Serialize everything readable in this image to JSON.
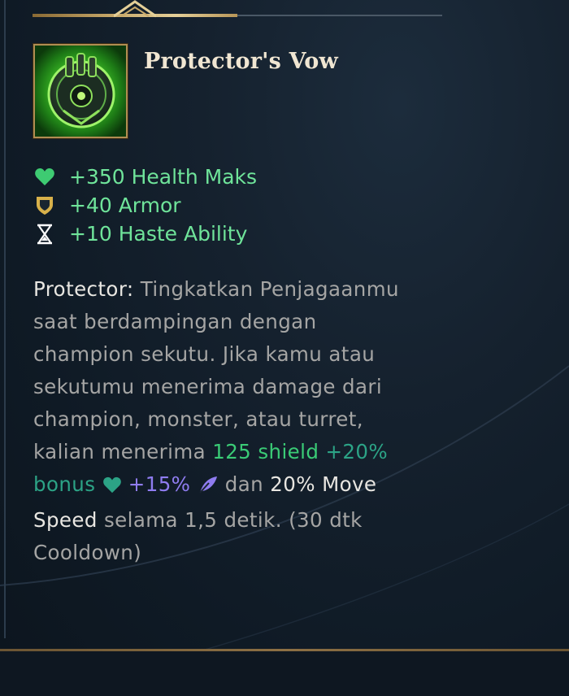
{
  "item": {
    "title": "Protector's Vow",
    "icon": "protectors-vow-item-icon"
  },
  "stats": [
    {
      "icon": "heart-icon",
      "text": "+350 Health Maks",
      "color": "#3ecb72"
    },
    {
      "icon": "shield-icon",
      "text": "+40 Armor",
      "color": "#d8b14a"
    },
    {
      "icon": "hourglass-icon",
      "text": "+10 Haste Ability",
      "color": "#ffffff"
    }
  ],
  "description": {
    "passive_name": "Protector:",
    "line1": "Tingkatkan Penjagaanmu",
    "line2": "saat berdampingan dengan",
    "line3": "champion sekutu. Jika kamu atau",
    "line4": "sekutumu menerima damage dari",
    "line5": "champion, monster, atau turret,",
    "line6_prefix": "kalian menerima ",
    "shield_value": "125 shield",
    "plus_sign": " +",
    "bonus_percent": "20%",
    "bonus_word": "bonus",
    "plus_ms_value": " +",
    "ms_value": "15%",
    "dan": " dan ",
    "move_speed_value": "20% Move",
    "speed_word": "Speed",
    "rest": " selama 1,5 detik. (30 dtk",
    "cooldown": "Cooldown)"
  },
  "colors": {
    "gold_border": "#b08d52",
    "stat_green": "#6fe49a",
    "health_green": "#3acb76",
    "bonus_teal": "#2ca386",
    "ms_purple": "#8f7cf0",
    "desc_gray": "#a5a5a4",
    "title_cream": "#f0e6d2"
  }
}
